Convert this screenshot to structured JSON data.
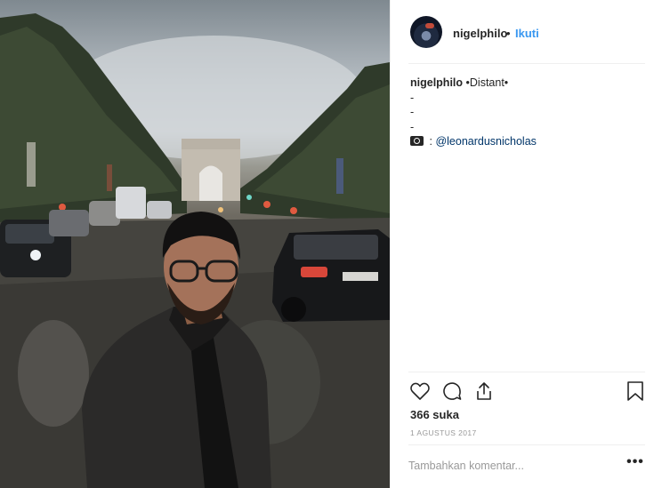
{
  "post": {
    "username": "nigelphilo",
    "separator": "•",
    "follow_label": "Ikuti",
    "caption": {
      "user": "nigelphilo",
      "text": "•Distant•",
      "lines": [
        "-",
        "-",
        "-"
      ],
      "credit_prefix": ":",
      "mention": "@leonardusnicholas"
    },
    "likes": "366 suka",
    "date": "1 AGUSTUS 2017",
    "comment_placeholder": "Tambahkan komentar...",
    "more_label": "•••"
  },
  "icons": {
    "like": "heart-icon",
    "comment": "comment-icon",
    "share": "share-icon",
    "save": "bookmark-icon",
    "camera": "camera-icon"
  },
  "colors": {
    "follow": "#3897f0",
    "mention": "#003569",
    "muted": "#999999",
    "text": "#262626"
  }
}
